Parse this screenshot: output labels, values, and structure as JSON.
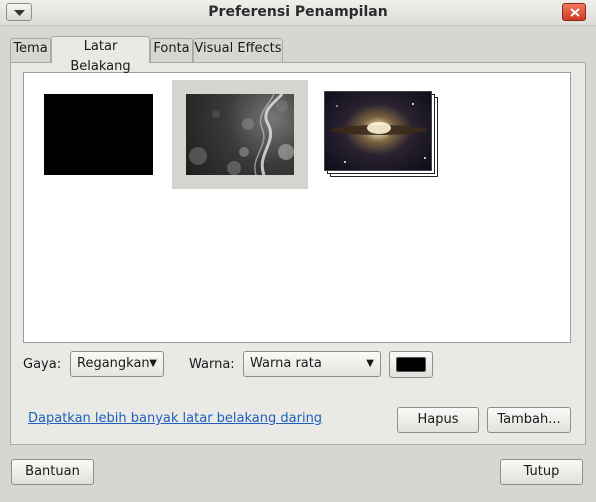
{
  "window": {
    "title": "Preferensi Penampilan"
  },
  "tabs": [
    {
      "label": "Tema"
    },
    {
      "label": "Latar Belakang",
      "active": true
    },
    {
      "label": "Fonta"
    },
    {
      "label": "Visual Effects"
    }
  ],
  "wallpapers": [
    {
      "name": "black-solid",
      "selected": false
    },
    {
      "name": "smoke-bokeh",
      "selected": true
    },
    {
      "name": "galaxy-slideshow",
      "selected": false
    }
  ],
  "style_row": {
    "style_label": "Gaya:",
    "style_value": "Regangkan",
    "color_label": "Warna:",
    "color_value": "Warna rata",
    "swatch_color": "#000000"
  },
  "actions": {
    "online_link": "Dapatkan lebih banyak latar belakang daring",
    "remove_button": "Hapus",
    "add_button": "Tambah..."
  },
  "footer": {
    "help_button": "Bantuan",
    "close_button": "Tutup"
  },
  "icons": {
    "menu": "chevron-down-icon",
    "close": "close-icon"
  }
}
